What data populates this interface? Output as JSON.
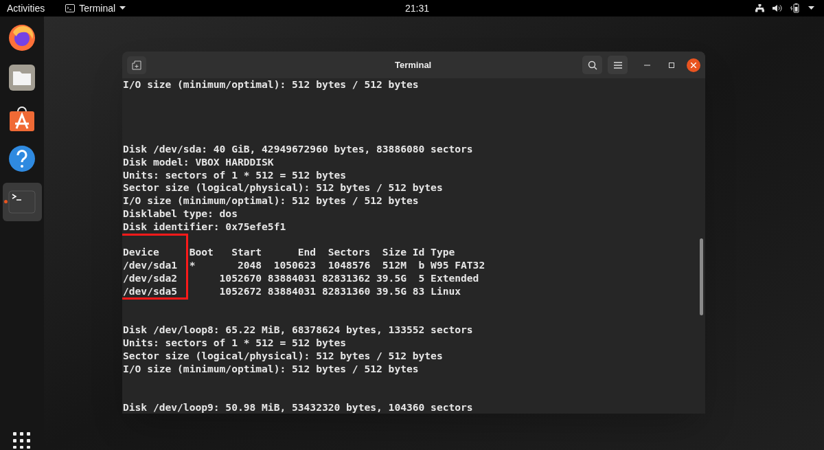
{
  "top_bar": {
    "activities": "Activities",
    "app_menu": "Terminal",
    "clock": "21:31"
  },
  "dock": {
    "items": [
      {
        "kind": "browser",
        "selected": false
      },
      {
        "kind": "files",
        "selected": false
      },
      {
        "kind": "store",
        "selected": false
      },
      {
        "kind": "help",
        "selected": false
      },
      {
        "kind": "terminal",
        "selected": true
      }
    ]
  },
  "window": {
    "title": "Terminal"
  },
  "terminal": {
    "lines": [
      {
        "kind": "text",
        "text": "I/O size (minimum/optimal): 512 bytes / 512 bytes"
      },
      {
        "kind": "blank"
      },
      {
        "kind": "blank"
      },
      {
        "kind": "blank"
      },
      {
        "kind": "blank"
      },
      {
        "kind": "text",
        "text": "Disk /dev/sda: 40 GiB, 42949672960 bytes, 83886080 sectors"
      },
      {
        "kind": "text",
        "text": "Disk model: VBOX HARDDISK"
      },
      {
        "kind": "text",
        "text": "Units: sectors of 1 * 512 = 512 bytes"
      },
      {
        "kind": "text",
        "text": "Sector size (logical/physical): 512 bytes / 512 bytes"
      },
      {
        "kind": "text",
        "text": "I/O size (minimum/optimal): 512 bytes / 512 bytes"
      },
      {
        "kind": "text",
        "text": "Disklabel type: dos"
      },
      {
        "kind": "text",
        "text": "Disk identifier: 0x75efe5f1"
      },
      {
        "kind": "blank"
      },
      {
        "kind": "text",
        "text": "Device     Boot   Start      End  Sectors  Size Id Type"
      },
      {
        "kind": "text",
        "text": "/dev/sda1  *       2048  1050623  1048576  512M  b W95 FAT32"
      },
      {
        "kind": "text",
        "text": "/dev/sda2       1052670 83884031 82831362 39.5G  5 Extended"
      },
      {
        "kind": "text",
        "text": "/dev/sda5       1052672 83884031 82831360 39.5G 83 Linux"
      },
      {
        "kind": "blank"
      },
      {
        "kind": "blank"
      },
      {
        "kind": "text",
        "text": "Disk /dev/loop8: 65.22 MiB, 68378624 bytes, 133552 sectors"
      },
      {
        "kind": "text",
        "text": "Units: sectors of 1 * 512 = 512 bytes"
      },
      {
        "kind": "text",
        "text": "Sector size (logical/physical): 512 bytes / 512 bytes"
      },
      {
        "kind": "text",
        "text": "I/O size (minimum/optimal): 512 bytes / 512 bytes"
      },
      {
        "kind": "blank"
      },
      {
        "kind": "blank"
      },
      {
        "kind": "text",
        "text": "Disk /dev/loop9: 50.98 MiB, 53432320 bytes, 104360 sectors"
      }
    ]
  }
}
